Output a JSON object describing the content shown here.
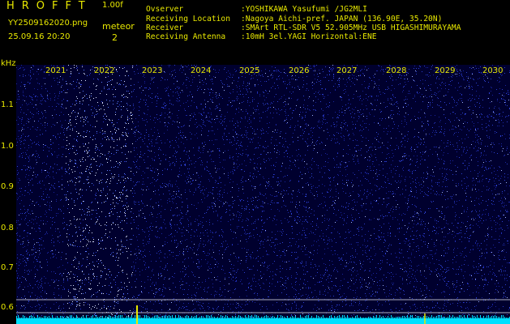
{
  "header": {
    "brand": "HROFFT",
    "version": "1.00f",
    "filename": "YY2509162020.png",
    "mode": "meteor",
    "timestamp": "25.09.16 20:20",
    "count": "2",
    "fields": [
      {
        "label": "Ovserver",
        "value": ":YOSHIKAWA Yasufumi /JG2MLI"
      },
      {
        "label": "Receiving Location",
        "value": ":Nagoya Aichi-pref. JAPAN (136.90E, 35.20N)"
      },
      {
        "label": "Receiver",
        "value": ":SMArt RTL-SDR V5 52.905MHz USB HIGASHIMURAYAMA"
      },
      {
        "label": "Receiving Antenna",
        "value": ":10mH 3el.YAGI Horizontal:ENE"
      }
    ]
  },
  "axes": {
    "y_unit": "kHz",
    "y_ticks": [
      "1.1",
      "1.0",
      "0.9",
      "0.8",
      "0.7",
      "0.6"
    ],
    "x_labels": [
      "2021",
      "2022",
      "2023",
      "2024",
      "2025",
      "2026",
      "2027",
      "2028",
      "2029",
      "2030"
    ]
  },
  "colors": {
    "background": "#000000",
    "text": "#e8e800",
    "spectrogram": "#00002e",
    "noise": "#3a56ff",
    "baseline": "#00e0ff",
    "echo": "#e8e800"
  }
}
